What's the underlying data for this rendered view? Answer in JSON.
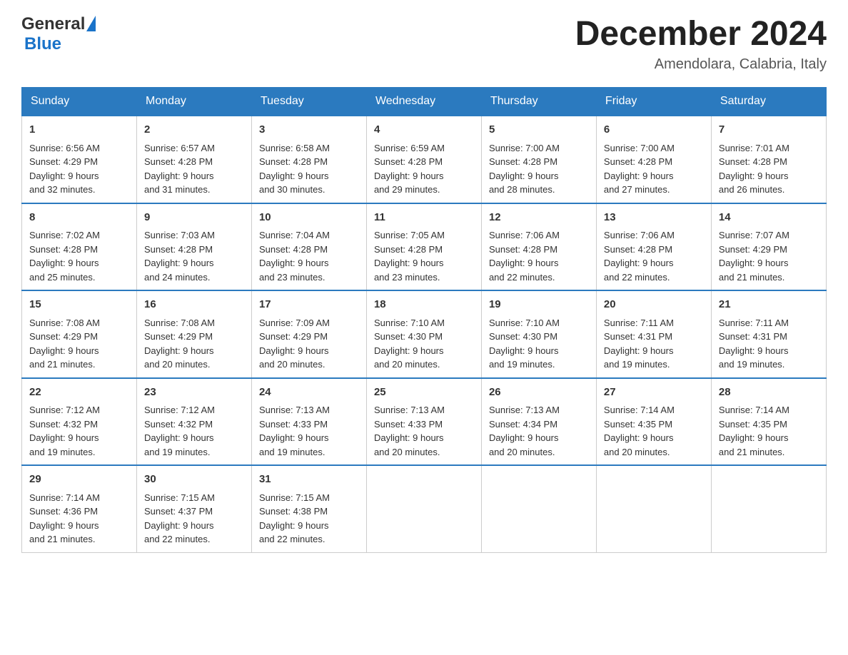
{
  "header": {
    "logo_general": "General",
    "logo_blue": "Blue",
    "month_title": "December 2024",
    "location": "Amendolara, Calabria, Italy"
  },
  "days_of_week": [
    "Sunday",
    "Monday",
    "Tuesday",
    "Wednesday",
    "Thursday",
    "Friday",
    "Saturday"
  ],
  "weeks": [
    [
      {
        "day": "1",
        "sunrise": "6:56 AM",
        "sunset": "4:29 PM",
        "daylight": "9 hours and 32 minutes."
      },
      {
        "day": "2",
        "sunrise": "6:57 AM",
        "sunset": "4:28 PM",
        "daylight": "9 hours and 31 minutes."
      },
      {
        "day": "3",
        "sunrise": "6:58 AM",
        "sunset": "4:28 PM",
        "daylight": "9 hours and 30 minutes."
      },
      {
        "day": "4",
        "sunrise": "6:59 AM",
        "sunset": "4:28 PM",
        "daylight": "9 hours and 29 minutes."
      },
      {
        "day": "5",
        "sunrise": "7:00 AM",
        "sunset": "4:28 PM",
        "daylight": "9 hours and 28 minutes."
      },
      {
        "day": "6",
        "sunrise": "7:00 AM",
        "sunset": "4:28 PM",
        "daylight": "9 hours and 27 minutes."
      },
      {
        "day": "7",
        "sunrise": "7:01 AM",
        "sunset": "4:28 PM",
        "daylight": "9 hours and 26 minutes."
      }
    ],
    [
      {
        "day": "8",
        "sunrise": "7:02 AM",
        "sunset": "4:28 PM",
        "daylight": "9 hours and 25 minutes."
      },
      {
        "day": "9",
        "sunrise": "7:03 AM",
        "sunset": "4:28 PM",
        "daylight": "9 hours and 24 minutes."
      },
      {
        "day": "10",
        "sunrise": "7:04 AM",
        "sunset": "4:28 PM",
        "daylight": "9 hours and 23 minutes."
      },
      {
        "day": "11",
        "sunrise": "7:05 AM",
        "sunset": "4:28 PM",
        "daylight": "9 hours and 23 minutes."
      },
      {
        "day": "12",
        "sunrise": "7:06 AM",
        "sunset": "4:28 PM",
        "daylight": "9 hours and 22 minutes."
      },
      {
        "day": "13",
        "sunrise": "7:06 AM",
        "sunset": "4:28 PM",
        "daylight": "9 hours and 22 minutes."
      },
      {
        "day": "14",
        "sunrise": "7:07 AM",
        "sunset": "4:29 PM",
        "daylight": "9 hours and 21 minutes."
      }
    ],
    [
      {
        "day": "15",
        "sunrise": "7:08 AM",
        "sunset": "4:29 PM",
        "daylight": "9 hours and 21 minutes."
      },
      {
        "day": "16",
        "sunrise": "7:08 AM",
        "sunset": "4:29 PM",
        "daylight": "9 hours and 20 minutes."
      },
      {
        "day": "17",
        "sunrise": "7:09 AM",
        "sunset": "4:29 PM",
        "daylight": "9 hours and 20 minutes."
      },
      {
        "day": "18",
        "sunrise": "7:10 AM",
        "sunset": "4:30 PM",
        "daylight": "9 hours and 20 minutes."
      },
      {
        "day": "19",
        "sunrise": "7:10 AM",
        "sunset": "4:30 PM",
        "daylight": "9 hours and 19 minutes."
      },
      {
        "day": "20",
        "sunrise": "7:11 AM",
        "sunset": "4:31 PM",
        "daylight": "9 hours and 19 minutes."
      },
      {
        "day": "21",
        "sunrise": "7:11 AM",
        "sunset": "4:31 PM",
        "daylight": "9 hours and 19 minutes."
      }
    ],
    [
      {
        "day": "22",
        "sunrise": "7:12 AM",
        "sunset": "4:32 PM",
        "daylight": "9 hours and 19 minutes."
      },
      {
        "day": "23",
        "sunrise": "7:12 AM",
        "sunset": "4:32 PM",
        "daylight": "9 hours and 19 minutes."
      },
      {
        "day": "24",
        "sunrise": "7:13 AM",
        "sunset": "4:33 PM",
        "daylight": "9 hours and 19 minutes."
      },
      {
        "day": "25",
        "sunrise": "7:13 AM",
        "sunset": "4:33 PM",
        "daylight": "9 hours and 20 minutes."
      },
      {
        "day": "26",
        "sunrise": "7:13 AM",
        "sunset": "4:34 PM",
        "daylight": "9 hours and 20 minutes."
      },
      {
        "day": "27",
        "sunrise": "7:14 AM",
        "sunset": "4:35 PM",
        "daylight": "9 hours and 20 minutes."
      },
      {
        "day": "28",
        "sunrise": "7:14 AM",
        "sunset": "4:35 PM",
        "daylight": "9 hours and 21 minutes."
      }
    ],
    [
      {
        "day": "29",
        "sunrise": "7:14 AM",
        "sunset": "4:36 PM",
        "daylight": "9 hours and 21 minutes."
      },
      {
        "day": "30",
        "sunrise": "7:15 AM",
        "sunset": "4:37 PM",
        "daylight": "9 hours and 22 minutes."
      },
      {
        "day": "31",
        "sunrise": "7:15 AM",
        "sunset": "4:38 PM",
        "daylight": "9 hours and 22 minutes."
      },
      null,
      null,
      null,
      null
    ]
  ],
  "labels": {
    "sunrise": "Sunrise:",
    "sunset": "Sunset:",
    "daylight": "Daylight:"
  }
}
